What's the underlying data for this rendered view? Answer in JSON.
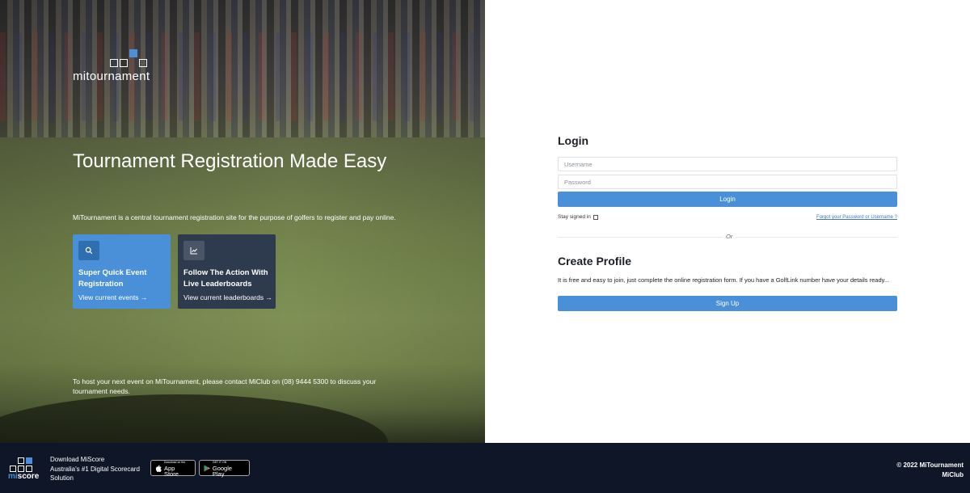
{
  "brand": {
    "name": "mitournament"
  },
  "hero": {
    "title": "Tournament Registration Made Easy",
    "subtitle": "MiTournament is a central tournament registration site for the purpose of golfers to register and pay online.",
    "cards": [
      {
        "icon": "search-icon",
        "title": "Super Quick Event Registration",
        "link": "View current events →"
      },
      {
        "icon": "chart-icon",
        "title": "Follow The Action With Live Leaderboards",
        "link": "View current leaderboards →"
      }
    ],
    "contact": "To host your next event on MiTournament, please contact MiClub on (08) 9444 5300 to discuss your tournament needs."
  },
  "login": {
    "title": "Login",
    "username_placeholder": "Username",
    "password_placeholder": "Password",
    "button": "Login",
    "stay_signed_in": "Stay signed in",
    "forgot": "Forgot your Password or Username ?",
    "or": "Or"
  },
  "create": {
    "title": "Create Profile",
    "description": "It is free and easy to join, just complete the online registration form. If you have a GolfLink number have your details ready...",
    "button": "Sign Up"
  },
  "footer": {
    "logo_mi": "mi",
    "logo_score": "score",
    "download_lines": [
      "Download MiScore",
      "Australia's #1 Digital Scorecard",
      "Solution"
    ],
    "app_store_small": "Download on the",
    "app_store_big": "App Store",
    "google_small": "GET IT ON",
    "google_big": "Google Play",
    "copyright": "© 2022 MiTournament",
    "company": "MiClub"
  },
  "colors": {
    "accent": "#4a90d9",
    "dark_card": "#2e3b4e",
    "footer": "#0e1628"
  }
}
